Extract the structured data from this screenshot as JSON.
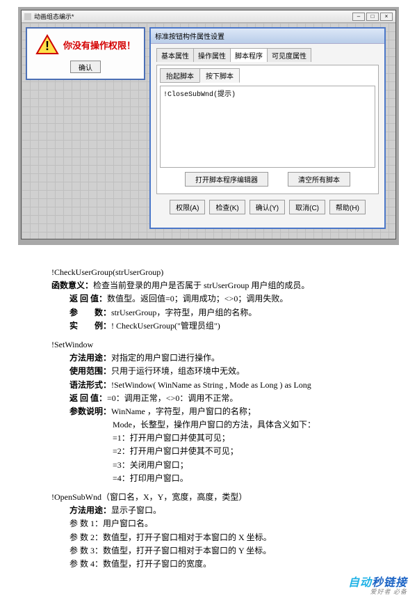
{
  "window": {
    "title": "动画组态编示*",
    "btn_min": "–",
    "btn_max": "□",
    "btn_close": "×"
  },
  "warn_popup": {
    "message": "你没有操作权限！",
    "ok": "确认"
  },
  "prop_dialog": {
    "title": "标准按钮构件属性设置",
    "tabs": [
      "基本属性",
      "操作属性",
      "脚本程序",
      "可见度属性"
    ],
    "subtabs": [
      "抬起脚本",
      "按下脚本"
    ],
    "script_content": "!CloseSubWnd(提示)",
    "btn_open_editor": "打开脚本程序编辑器",
    "btn_clear": "清空所有脚本",
    "buttons": [
      "权限(A)",
      "检查(K)",
      "确认(Y)",
      "取消(C)",
      "帮助(H)"
    ]
  },
  "doc": {
    "fn1_sig": "!CheckUserGroup(strUserGroup)",
    "fn1_meaning_l": "函数意义：",
    "fn1_meaning_v": "检查当前登录的用户是否属于 strUserGroup 用户组的成员。",
    "fn1_return_l": "返 回 值：",
    "fn1_return_v": "数值型。返回值=0；调用成功；<>0；调用失败。",
    "fn1_param_l": "参　　数：",
    "fn1_param_v": "strUserGroup，字符型，用户组的名称。",
    "fn1_example_l": "实　　例：",
    "fn1_example_v": "! CheckUserGroup(\"管理员组\")",
    "fn2_sig": "!SetWindow",
    "fn2_use_l": "方法用途：",
    "fn2_use_v": "对指定的用户窗口进行操作。",
    "fn2_scope_l": "使用范围：",
    "fn2_scope_v": "只用于运行环境，组态环境中无效。",
    "fn2_syntax_l": "语法形式：",
    "fn2_syntax_v": "!SetWindow( WinName as String , Mode as Long ) as Long",
    "fn2_return_l": "返 回 值：",
    "fn2_return_v": "=0：调用正常，<>0：调用不正常。",
    "fn2_params_l": "参数说明：",
    "fn2_params_v": "WinName ，字符型，用户窗口的名称；",
    "fn2_mode": "Mode，长整型，操作用户窗口的方法，具体含义如下：",
    "fn2_m1": "=1：打开用户窗口并使其可见；",
    "fn2_m2": "=2：打开用户窗口并使其不可见；",
    "fn2_m3": "=3：关闭用户窗口；",
    "fn2_m4": "=4：打印用户窗口。",
    "fn3_sig": "!OpenSubWnd（窗口名，X，Y，宽度，高度，类型）",
    "fn3_use_l": "方法用途：",
    "fn3_use_v": "显示子窗口。",
    "fn3_p1": "参 数 1：用户窗口名。",
    "fn3_p2": "参 数 2：数值型，打开子窗口相对于本窗口的 X 坐标。",
    "fn3_p3": "参 数 3：数值型，打开子窗口相对于本窗口的 Y 坐标。",
    "fn3_p4": "参 数 4：数值型，打开子窗口的宽度。"
  },
  "watermark": {
    "a": "自动",
    "b": "秒链接",
    "c": "爱好者 必备"
  }
}
